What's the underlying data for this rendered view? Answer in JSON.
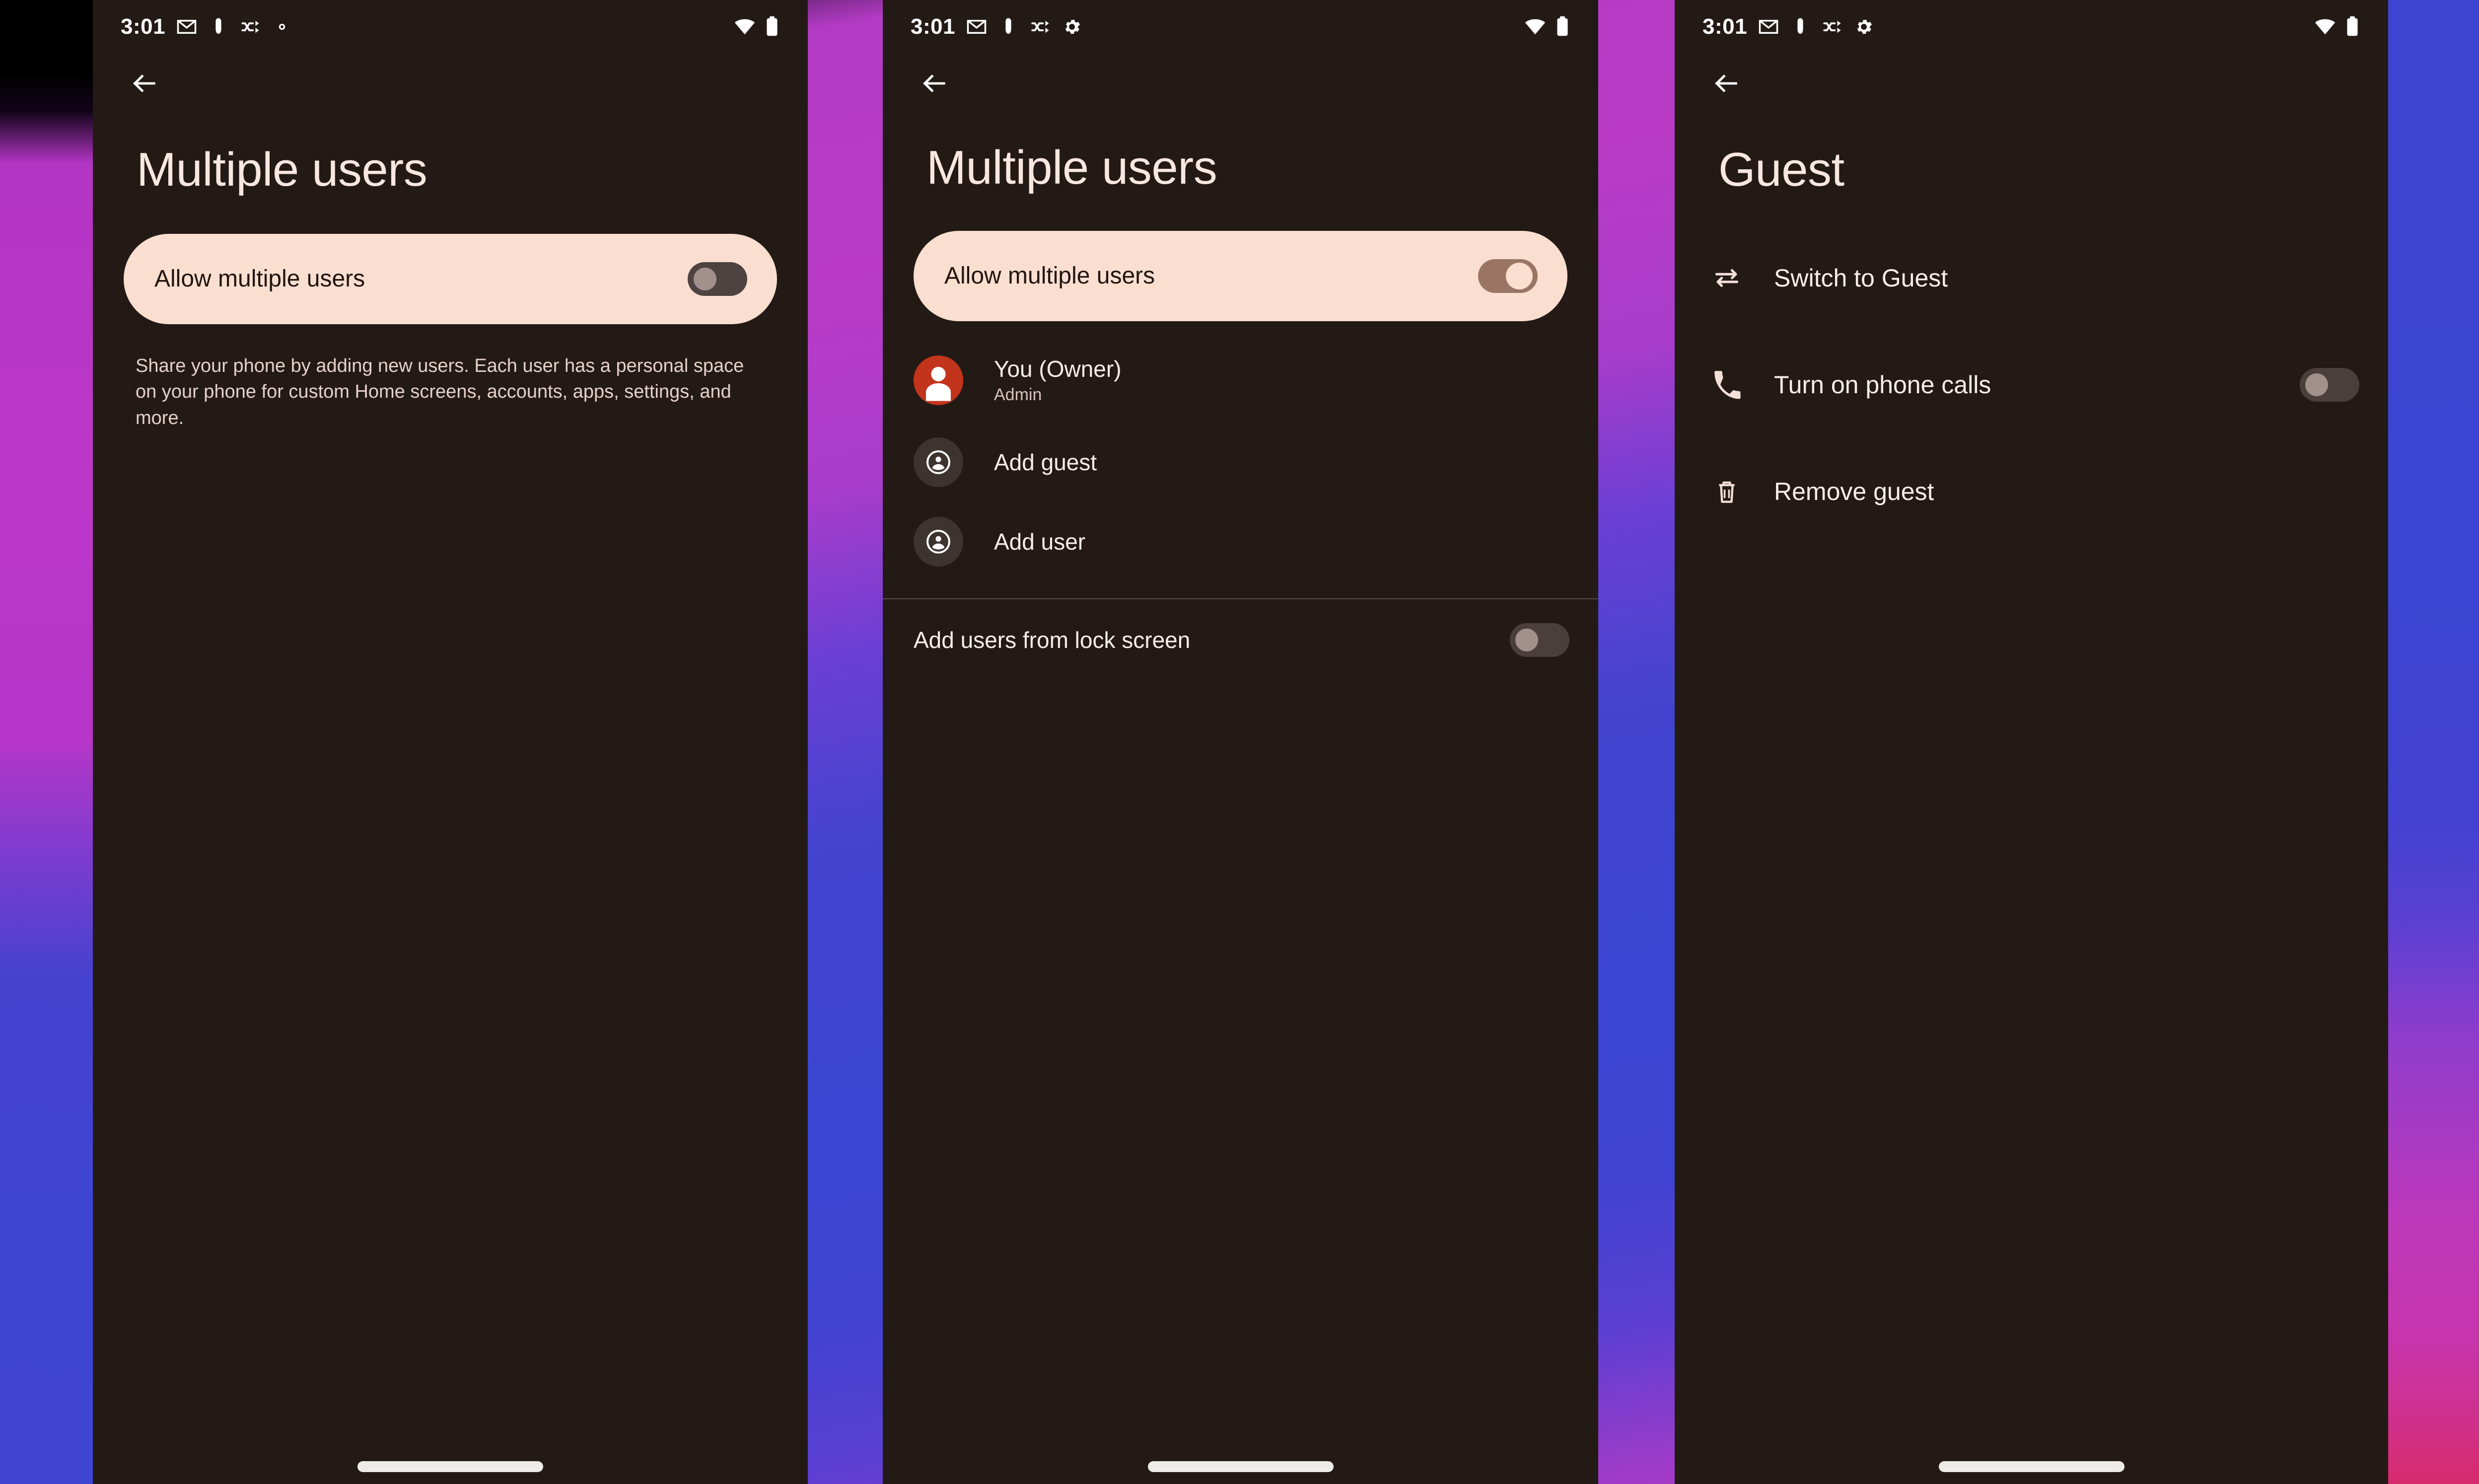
{
  "theme": {
    "screen_bg": "#231A16",
    "accent_card_bg": "#FADFD0",
    "title_color": "#F8E7E1",
    "owner_avatar_color": "#C3341C",
    "switch_on_track": "#9A7563",
    "switch_off_track": "#4E4340",
    "switch_off_knob": "#A2908D",
    "nav_handle_color": "#EEEBE9"
  },
  "status_bar": {
    "time": "3:01",
    "icons_left": [
      "gmail-icon",
      "person-standing-icon",
      "shuffle-icon",
      "gear-icon"
    ],
    "icons_right": [
      "wifi-icon",
      "battery-icon"
    ]
  },
  "panels": [
    {
      "name": "multiple-users-disabled",
      "back_icon": "back-arrow-icon",
      "title": "Multiple users",
      "allow_card": {
        "label": "Allow multiple users",
        "switch_state": "off"
      },
      "description": "Share your phone by adding new users. Each user has a personal space on your phone for custom Home screens, accounts, apps, settings, and more.",
      "nav_handle": "gesture-nav-handle"
    },
    {
      "name": "multiple-users-enabled",
      "back_icon": "back-arrow-icon",
      "title": "Multiple users",
      "allow_card": {
        "label": "Allow multiple users",
        "switch_state": "on"
      },
      "users": [
        {
          "name": "You (Owner)",
          "subtitle": "Admin",
          "avatar_icon": "person-avatar-icon",
          "avatar_style": "owner"
        },
        {
          "name": "Add guest",
          "subtitle": "",
          "avatar_icon": "account-circle-icon",
          "avatar_style": "add"
        },
        {
          "name": "Add user",
          "subtitle": "",
          "avatar_icon": "account-circle-icon",
          "avatar_style": "add"
        }
      ],
      "lock_screen_setting": {
        "label": "Add users from lock screen",
        "switch_state": "off"
      },
      "nav_handle": "gesture-nav-handle"
    },
    {
      "name": "guest-settings",
      "back_icon": "back-arrow-icon",
      "title": "Guest",
      "actions": [
        {
          "label": "Switch to Guest",
          "icon": "swap-horiz-icon",
          "switch_state": null
        },
        {
          "label": "Turn on phone calls",
          "icon": "phone-icon",
          "switch_state": "off"
        },
        {
          "label": "Remove guest",
          "icon": "trash-icon",
          "switch_state": null
        }
      ],
      "nav_handle": "gesture-nav-handle"
    }
  ]
}
